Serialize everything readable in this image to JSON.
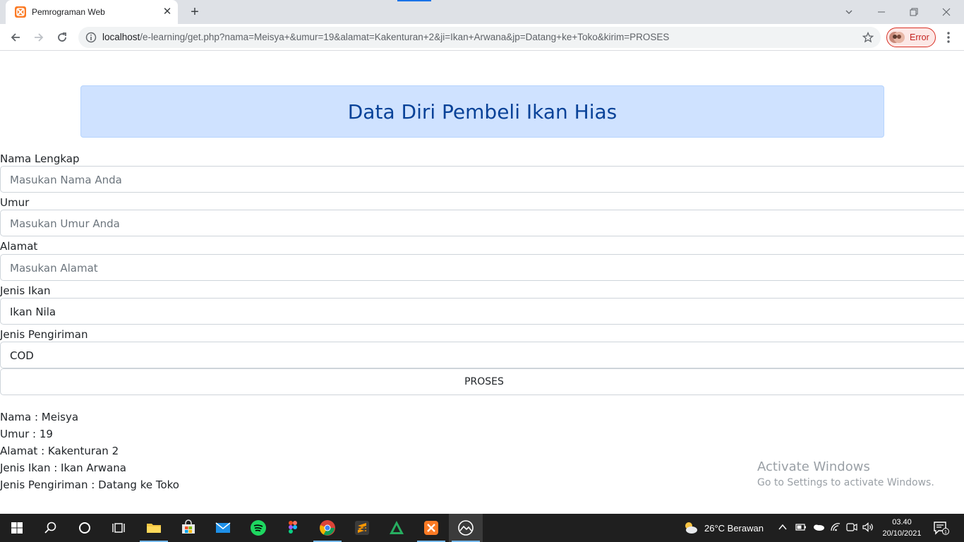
{
  "browser": {
    "tab_title": "Pemrograman Web",
    "url_host": "localhost",
    "url_path": "/e-learning/get.php?nama=Meisya+&umur=19&alamat=Kakenturan+2&ji=Ikan+Arwana&jp=Datang+ke+Toko&kirim=PROSES",
    "profile_status": "Error",
    "colors": {
      "accent": "#1a73e8",
      "profile_error": "#d93025"
    }
  },
  "form": {
    "title": "Data Diri Pembeli Ikan Hias",
    "nama_label": "Nama Lengkap",
    "nama_placeholder": "Masukan Nama Anda",
    "umur_label": "Umur",
    "umur_placeholder": "Masukan Umur Anda",
    "alamat_label": "Alamat",
    "alamat_placeholder": "Masukan Alamat",
    "jenis_ikan_label": "Jenis Ikan",
    "jenis_ikan_value": "Ikan Nila",
    "pengiriman_label": "Jenis Pengiriman",
    "pengiriman_value": "COD",
    "submit_label": "PROSES",
    "colors": {
      "header_bg": "#cfe2ff",
      "header_text": "#084298"
    }
  },
  "result": {
    "nama": "Nama : Meisya",
    "umur": "Umur : 19",
    "alamat": "Alamat : Kakenturan 2",
    "jenis_ikan": "Jenis Ikan : Ikan Arwana",
    "pengiriman": "Jenis Pengiriman : Datang ke Toko"
  },
  "watermark": {
    "line1": "Activate Windows",
    "line2": "Go to Settings to activate Windows."
  },
  "taskbar": {
    "weather": "26°C  Berawan",
    "time": "03.40",
    "date": "20/10/2021",
    "notification_count": "1",
    "apps": [
      "start-icon",
      "search-icon",
      "cortana-icon",
      "task-view-icon",
      "file-explorer-icon",
      "store-icon",
      "mail-icon",
      "spotify-icon",
      "figma-icon",
      "chrome-icon",
      "sublime-icon",
      "maple-icon",
      "xampp-icon",
      "photos-icon"
    ]
  }
}
